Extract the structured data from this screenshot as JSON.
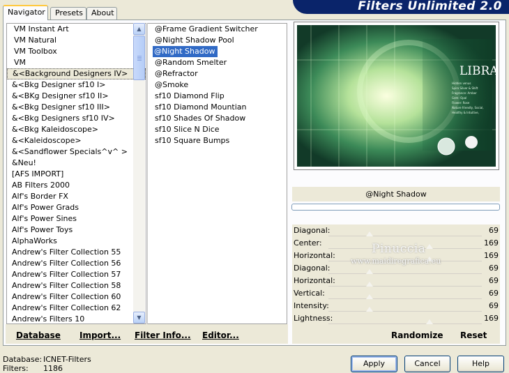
{
  "tabs": [
    {
      "label": "Navigator",
      "active": true
    },
    {
      "label": "Presets",
      "active": false
    },
    {
      "label": "About",
      "active": false
    }
  ],
  "banner_title": "Filters Unlimited 2.0",
  "categories": [
    "VM Instant Art",
    "VM Natural",
    "VM Toolbox",
    "VM",
    "&<Background Designers IV>",
    "&<Bkg Designer sf10 I>",
    "&<BKg Designer sf10 II>",
    "&<Bkg Designer sf10 III>",
    "&<Bkg Designers sf10 IV>",
    "&<Bkg Kaleidoscope>",
    "&<Kaleidoscope>",
    "&<Sandflower Specials^v^ >",
    "&Neu!",
    "[AFS IMPORT]",
    "AB Filters 2000",
    "Alf's Border FX",
    "Alf's Power Grads",
    "Alf's Power Sines",
    "Alf's Power Toys",
    "AlphaWorks",
    "Andrew's Filter Collection 55",
    "Andrew's Filter Collection 56",
    "Andrew's Filter Collection 57",
    "Andrew's Filter Collection 58",
    "Andrew's Filter Collection 60",
    "Andrew's Filter Collection 62",
    "Andrew's Filters 10"
  ],
  "selected_category_index": 4,
  "filters": [
    "@Frame Gradient Switcher",
    "@Night Shadow Pool",
    "@Night Shadow",
    "@Random Smelter",
    "@Refractor",
    "@Smoke",
    "sf10 Diamond Flip",
    "sf10 Diamond Mountian",
    "sf10 Shades Of Shadow",
    "sf10 Slice N Dice",
    "sf10 Square Bumps"
  ],
  "selected_filter_index": 2,
  "preview": {
    "title": "LIBRA",
    "caption_lines": [
      "Hidden venus",
      "Spiro Silver & Shift",
      "Fragrance: Amber",
      "Gem: Opal",
      "Flower: Rose",
      "Nature friendly, Social,",
      "Healthy & Intuitive,"
    ]
  },
  "filter_name": "@Night Shadow",
  "progress": 0,
  "params": [
    {
      "label": "Diagonal:",
      "value": "69",
      "fraction": 0.27
    },
    {
      "label": "Center:",
      "value": "169",
      "fraction": 0.66
    },
    {
      "label": "Horizontal:",
      "value": "169",
      "fraction": 0.66
    },
    {
      "label": "Diagonal:",
      "value": "69",
      "fraction": 0.27
    },
    {
      "label": "Horizontal:",
      "value": "69",
      "fraction": 0.27
    },
    {
      "label": "Vertical:",
      "value": "69",
      "fraction": 0.27
    },
    {
      "label": "Intensity:",
      "value": "69",
      "fraction": 0.27
    },
    {
      "label": "Lightness:",
      "value": "169",
      "fraction": 0.66
    }
  ],
  "watermark": {
    "name": "Pinuccia",
    "site": "www.maidiregrafica.eu"
  },
  "left_actions": {
    "database": "Database",
    "import": "Import...",
    "filter_info": "Filter Info...",
    "editor": "Editor..."
  },
  "right_actions": {
    "randomize": "Randomize",
    "reset": "Reset"
  },
  "status": {
    "db_label": "Database:",
    "db_value": "ICNET-Filters",
    "filters_label": "Filters:",
    "filters_value": "1186"
  },
  "buttons": {
    "apply": "Apply",
    "cancel": "Cancel",
    "help": "Help"
  }
}
